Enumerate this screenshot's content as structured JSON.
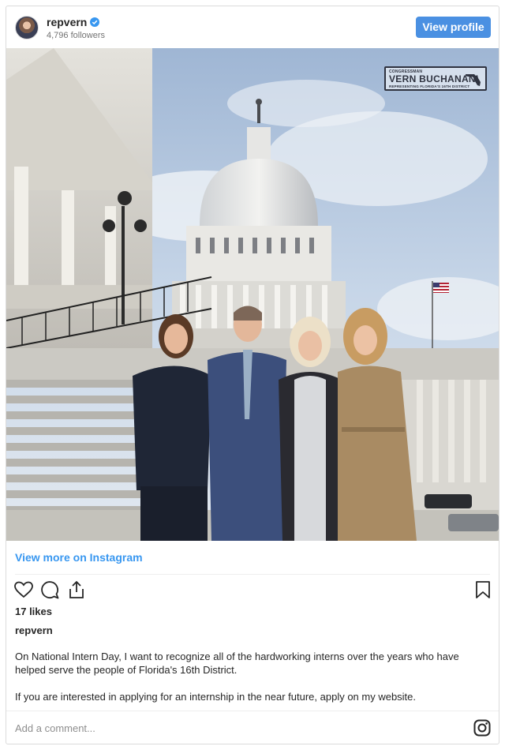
{
  "header": {
    "username": "repvern",
    "followers": "4,796 followers",
    "view_profile_label": "View profile"
  },
  "photo": {
    "watermark": {
      "top_line": "CONGRESSMAN",
      "name": "VERN BUCHANAN",
      "sub_line": "REPRESENTING FLORIDA'S 16TH DISTRICT"
    }
  },
  "links": {
    "view_more": "View more on Instagram"
  },
  "stats": {
    "likes": "17 likes"
  },
  "caption": {
    "username": "repvern",
    "paragraphs": [
      "On National Intern Day, I want to recognize all of the hardworking interns over the years who have helped serve the people of Florida's 16th District.",
      "If you are interested in applying for an internship in the near future, apply on my website."
    ]
  },
  "comment": {
    "placeholder": "Add a comment..."
  },
  "icons": {
    "verified": "verified-badge-icon",
    "like": "heart-icon",
    "comment": "comment-bubble-icon",
    "share": "share-icon",
    "save": "bookmark-icon",
    "brand": "instagram-icon"
  },
  "colors": {
    "accent": "#4a90e2",
    "link": "#3897f0",
    "text": "#262626",
    "muted": "#737373"
  }
}
